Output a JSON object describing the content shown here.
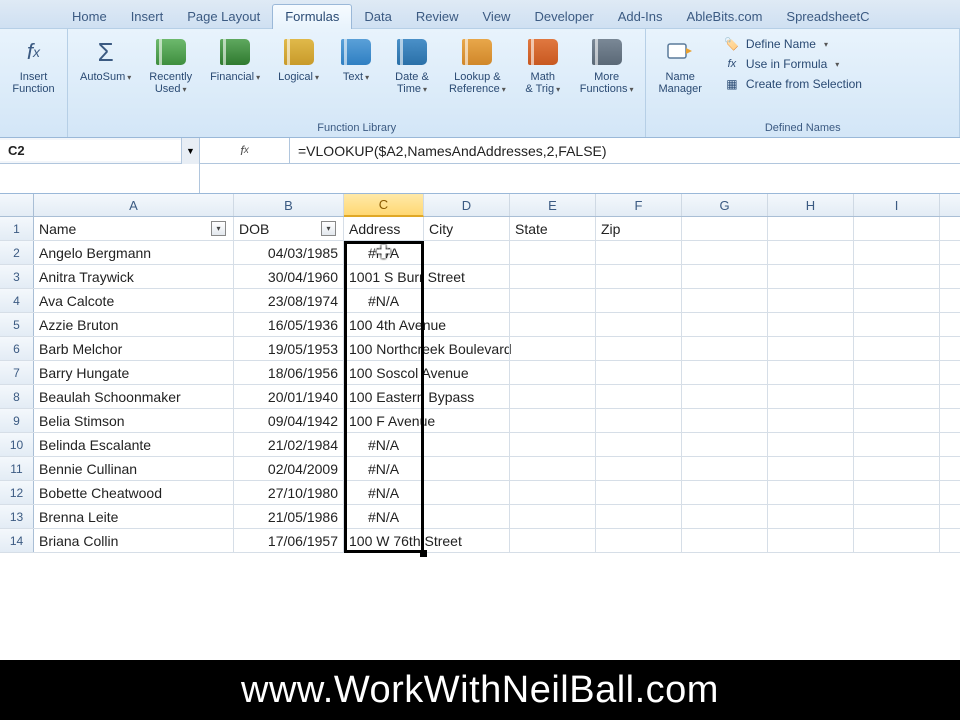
{
  "tabs": [
    "Home",
    "Insert",
    "Page Layout",
    "Formulas",
    "Data",
    "Review",
    "View",
    "Developer",
    "Add-Ins",
    "AbleBits.com",
    "SpreadsheetC"
  ],
  "activeTab": "Formulas",
  "ribbon": {
    "insertFunction": "Insert\nFunction",
    "fnLib": {
      "label": "Function Library",
      "items": [
        "AutoSum",
        "Recently\nUsed",
        "Financial",
        "Logical",
        "Text",
        "Date &\nTime",
        "Lookup &\nReference",
        "Math\n& Trig",
        "More\nFunctions"
      ]
    },
    "defNames": {
      "nameManager": "Name\nManager",
      "label": "Defined Names",
      "items": [
        "Define Name",
        "Use in Formula",
        "Create from Selection"
      ]
    }
  },
  "nameBox": "C2",
  "formula": "=VLOOKUP($A2,NamesAndAddresses,2,FALSE)",
  "columns": [
    "A",
    "B",
    "C",
    "D",
    "E",
    "F",
    "G",
    "H",
    "I"
  ],
  "selectedCol": "C",
  "headers": {
    "a": "Name",
    "b": "DOB",
    "c": "Address",
    "d": "City",
    "e": "State",
    "f": "Zip"
  },
  "rows": [
    {
      "n": "1"
    },
    {
      "n": "2",
      "a": "Angelo Bergmann",
      "b": "04/03/1985",
      "c": "#N/A"
    },
    {
      "n": "3",
      "a": "Anitra Traywick",
      "b": "30/04/1960",
      "c": "1001 S Burr Street"
    },
    {
      "n": "4",
      "a": "Ava Calcote",
      "b": "23/08/1974",
      "c": "#N/A"
    },
    {
      "n": "5",
      "a": "Azzie Bruton",
      "b": "16/05/1936",
      "c": "100 4th Avenue"
    },
    {
      "n": "6",
      "a": "Barb Melchor",
      "b": "19/05/1953",
      "c": "100 Northcreek Boulevard"
    },
    {
      "n": "7",
      "a": "Barry Hungate",
      "b": "18/06/1956",
      "c": "100 Soscol Avenue"
    },
    {
      "n": "8",
      "a": "Beaulah Schoonmaker",
      "b": "20/01/1940",
      "c": "100 Eastern Bypass"
    },
    {
      "n": "9",
      "a": "Belia Stimson",
      "b": "09/04/1942",
      "c": "100 F Avenue"
    },
    {
      "n": "10",
      "a": "Belinda Escalante",
      "b": "21/02/1984",
      "c": "#N/A"
    },
    {
      "n": "11",
      "a": "Bennie Cullinan",
      "b": "02/04/2009",
      "c": "#N/A"
    },
    {
      "n": "12",
      "a": "Bobette Cheatwood",
      "b": "27/10/1980",
      "c": "#N/A"
    },
    {
      "n": "13",
      "a": "Brenna Leite",
      "b": "21/05/1986",
      "c": "#N/A"
    },
    {
      "n": "14",
      "a": "Briana Collin",
      "b": "17/06/1957",
      "c": "100 W 76th Street"
    }
  ],
  "banner": "www.WorkWithNeilBall.com"
}
